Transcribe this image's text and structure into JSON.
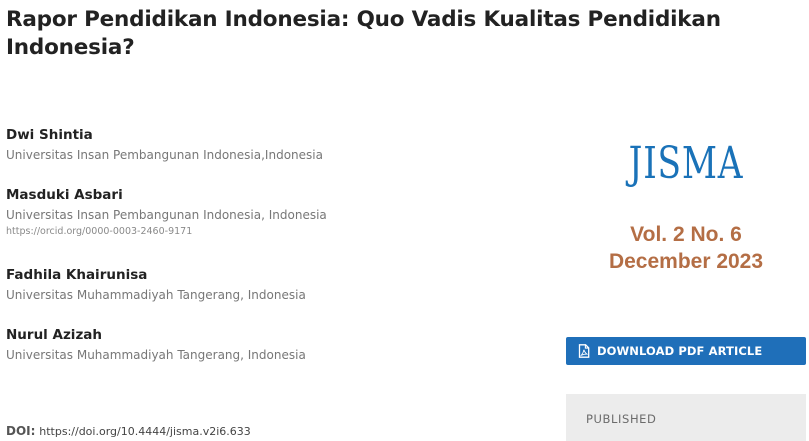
{
  "article": {
    "title": "Rapor Pendidikan Indonesia: Quo Vadis Kualitas Pendidikan Indonesia?"
  },
  "authors": [
    {
      "name": "Dwi Shintia",
      "affiliation": "Universitas Insan Pembangunan Indonesia,Indonesia"
    },
    {
      "name": "Masduki Asbari",
      "affiliation": "Universitas Insan Pembangunan Indonesia, Indonesia",
      "orcid": "https://orcid.org/0000-0003-2460-9171"
    },
    {
      "name": "Fadhila Khairunisa",
      "affiliation": "Universitas Muhammadiyah Tangerang, Indonesia"
    },
    {
      "name": "Nurul Azizah",
      "affiliation": "Universitas Muhammadiyah Tangerang, Indonesia"
    }
  ],
  "doi": {
    "label": "DOI:",
    "value": "https://doi.org/10.4444/jisma.v2i6.633"
  },
  "cover": {
    "logo_text": "JISMA",
    "volume": "Vol. 2  No. 6",
    "date": "December 2023"
  },
  "sidebar": {
    "download_label": "DOWNLOAD PDF ARTICLE",
    "published_label": "PUBLISHED"
  },
  "colors": {
    "accent": "#1f6fb9",
    "logo": "#1a72b8",
    "cover_text": "#b46e45",
    "muted": "#777777"
  },
  "icons": {
    "download": "pdf-file-icon"
  }
}
